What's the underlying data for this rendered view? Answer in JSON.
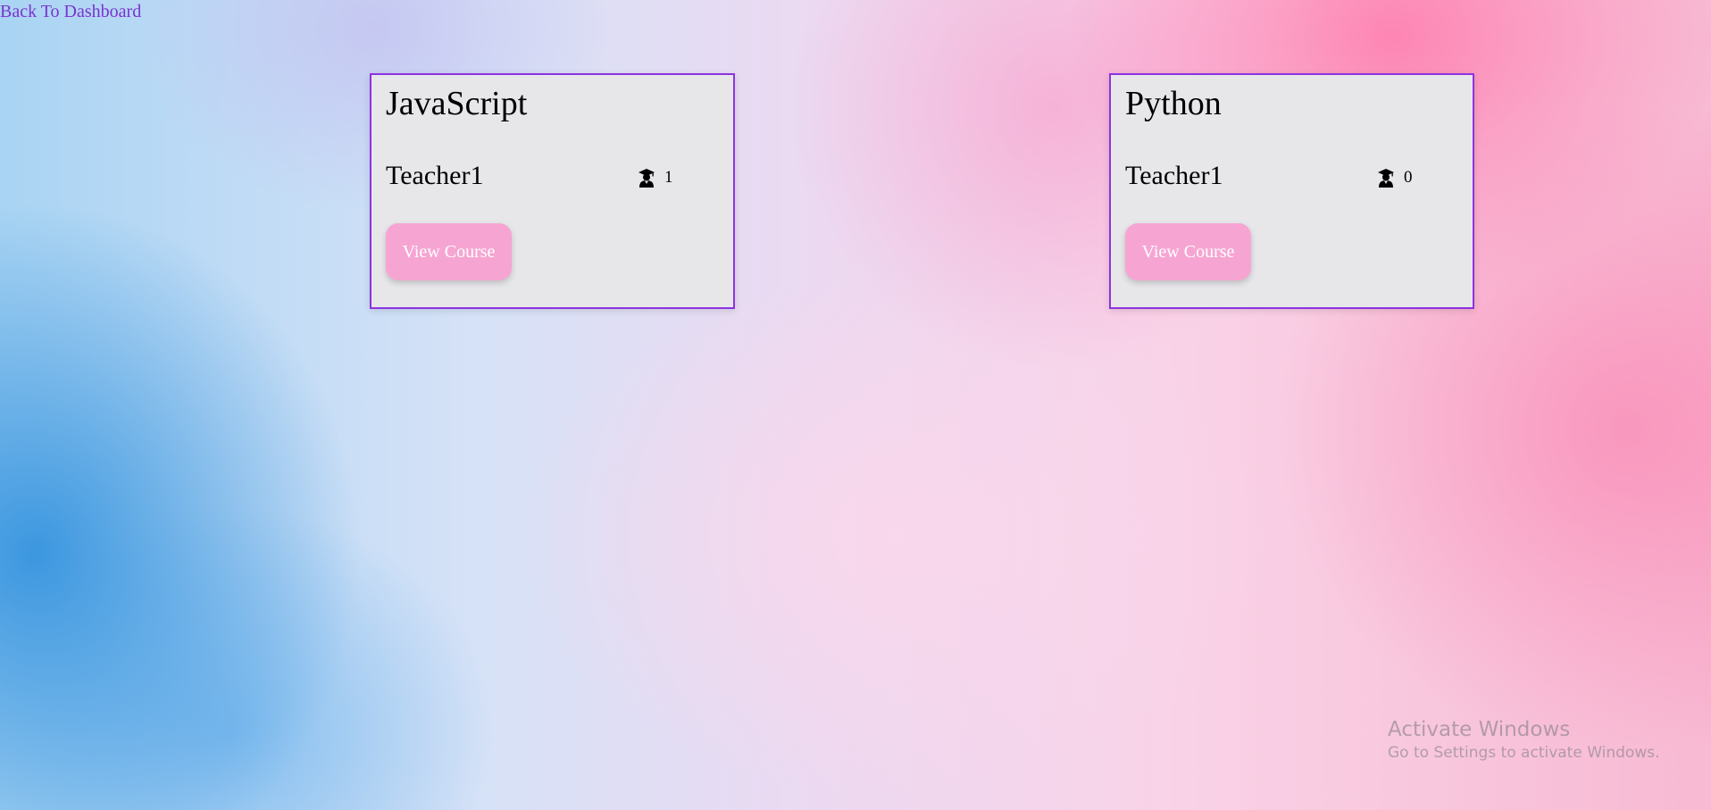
{
  "nav": {
    "back_label": "Back To Dashboard"
  },
  "courses": [
    {
      "title": "JavaScript",
      "teacher": "Teacher1",
      "student_count": "1",
      "button_label": "View Course"
    },
    {
      "title": "Python",
      "teacher": "Teacher1",
      "student_count": "0",
      "button_label": "View Course"
    }
  ],
  "icons": {
    "student": "graduate-student-icon"
  },
  "colors": {
    "link": "#7a32d0",
    "card_border": "#8d33e0",
    "card_background": "#e7e7ea",
    "button_background": "#f6a5d3",
    "button_text": "#ffffff"
  },
  "watermark": {
    "title": "Activate Windows",
    "subtitle": "Go to Settings to activate Windows."
  }
}
